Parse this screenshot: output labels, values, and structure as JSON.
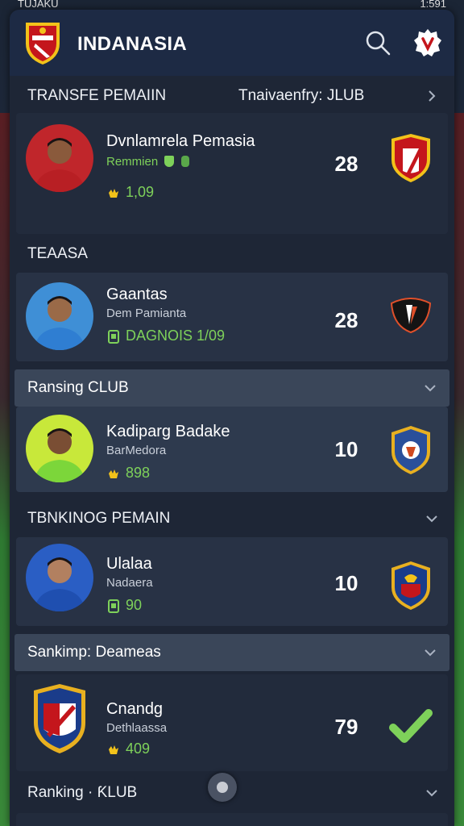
{
  "status_bar": {
    "left": "TUJAKU",
    "right": "1:591"
  },
  "app": {
    "title": "INDANASIA"
  },
  "sections": [
    {
      "label": "TRANSFE PEMAIIN",
      "right": "Tnaivaenfry: JLUB"
    },
    {
      "label": "TEAASA"
    },
    {
      "label": "Ransing CLUB"
    },
    {
      "label": "TBNKINOG PEMAIN"
    },
    {
      "label": "Sankimp: Deameas"
    },
    {
      "label": "Ranking · ƘLUB"
    }
  ],
  "rows": [
    {
      "name": "Dvnlamrela Pemasia",
      "sub": "Remmien",
      "stat": "1,09",
      "stat_icon": "hand-icon",
      "number": "28",
      "avatar_color": "#c0262b",
      "badge_icon": "club-shield-red-icon"
    },
    {
      "name": "Gaantas",
      "sub": "Dem Pamianta",
      "stat": "DAGNOIS 1/09",
      "stat_icon": "card-icon",
      "number": "28",
      "avatar_color": "#3f8fd6",
      "badge_icon": "club-crest-black-icon"
    },
    {
      "name": "Kadiparg Badake",
      "sub": "BarMedora",
      "stat": "898",
      "stat_icon": "hand-icon",
      "number": "10",
      "avatar_color": "#c8e83a",
      "badge_icon": "club-shield-blue-icon"
    },
    {
      "name": "Ulalaa",
      "sub": "Nadaera",
      "stat": "90",
      "stat_icon": "card-icon",
      "number": "10",
      "avatar_color": "#2a5ec4",
      "badge_icon": "club-shield-navy-icon"
    },
    {
      "name": "Cnandg",
      "sub": "Dethlaassa",
      "stat": "409",
      "stat_icon": "hand-icon",
      "number": "79",
      "avatar_color": "#2b3548",
      "badge_icon": "check-icon"
    }
  ],
  "colors": {
    "accent_green": "#7ed15a",
    "panel": "#1e2636",
    "appbar": "#1d2a44"
  }
}
